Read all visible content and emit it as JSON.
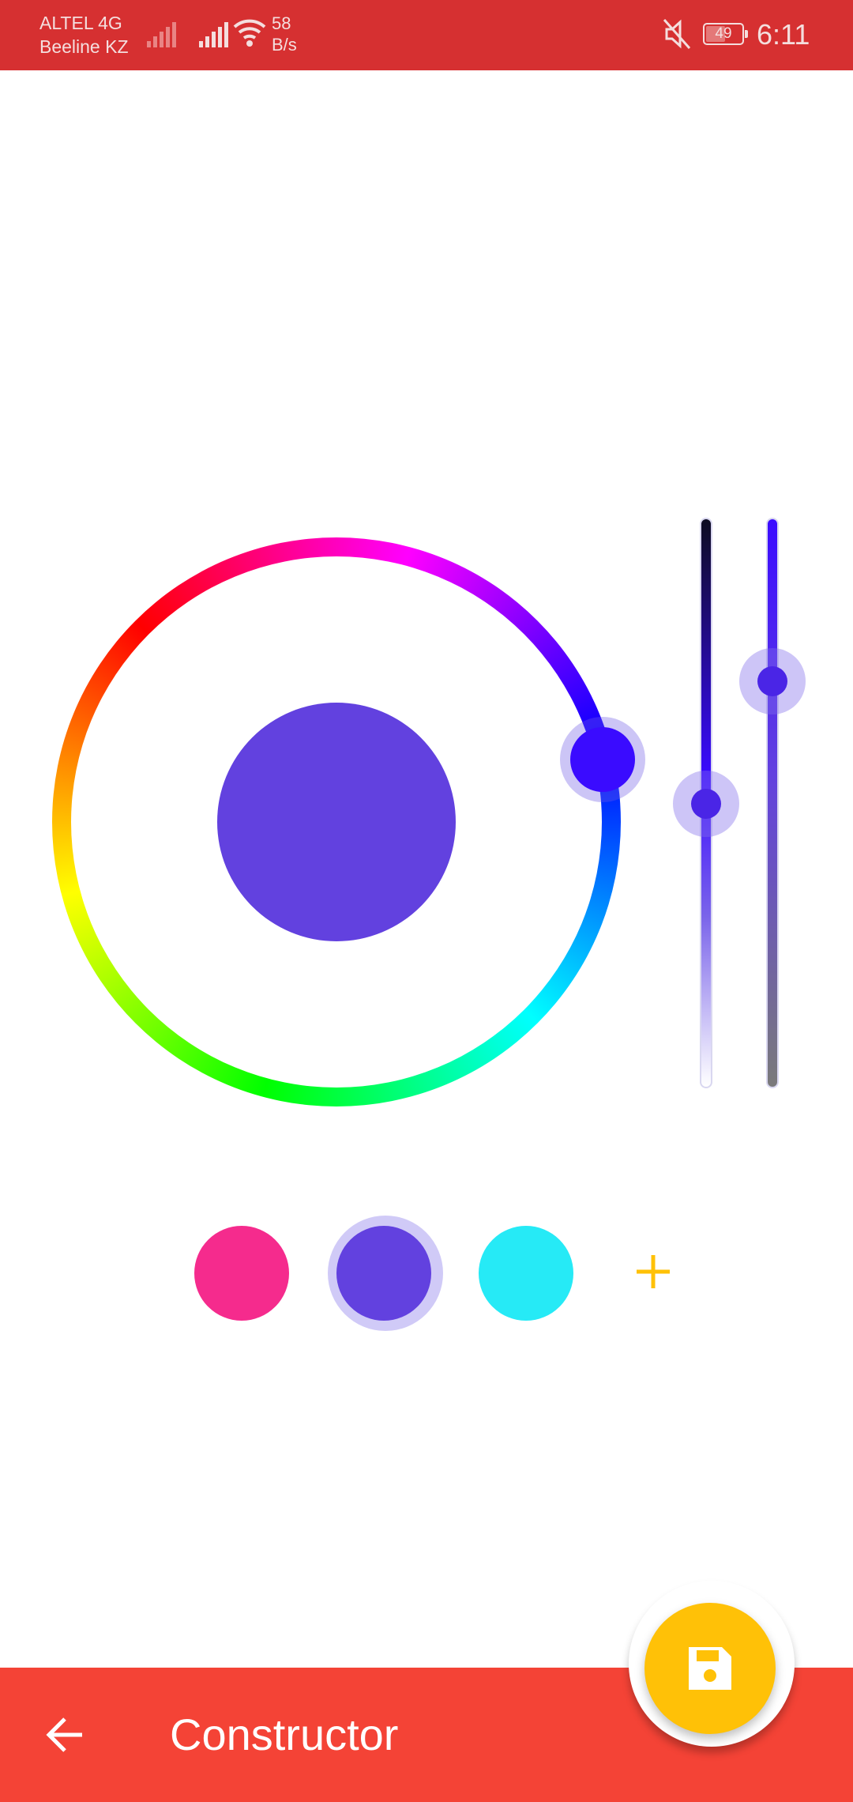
{
  "status_bar": {
    "carrier_1": "ALTEL 4G",
    "carrier_2": "Beeline KZ",
    "speed_value": "58",
    "speed_unit": "B/s",
    "battery": "49",
    "time": "6:11"
  },
  "color_picker": {
    "selected_color": "#6241df",
    "hue_handle_color": "#3a0bff",
    "slider_1_value_percent": 50,
    "slider_2_value_percent": 29
  },
  "swatches": [
    {
      "color": "#f52b8d",
      "selected": false
    },
    {
      "color": "#6241df",
      "selected": true
    },
    {
      "color": "#26eaf6",
      "selected": false
    }
  ],
  "add_swatch_icon": "plus-icon",
  "app_bar": {
    "title": "Constructor",
    "back_icon": "arrow-left-icon",
    "save_icon": "floppy-disk-icon",
    "bar_color": "#f44336",
    "fab_color": "#ffc107"
  }
}
